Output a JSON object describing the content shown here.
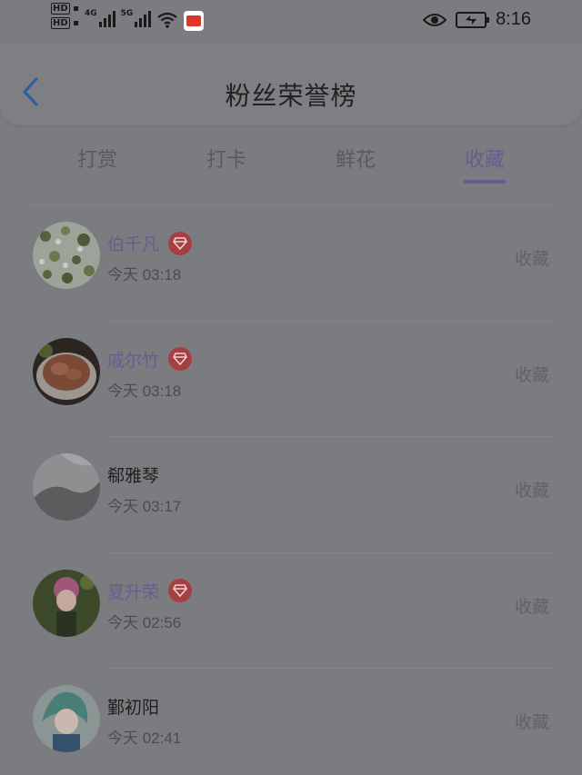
{
  "status_bar": {
    "hd1": "HD",
    "hd2": "HD",
    "net1": "4G",
    "net2": "5G",
    "time": "8:16"
  },
  "header": {
    "title": "粉丝荣誉榜"
  },
  "tabs": [
    {
      "label": "打赏"
    },
    {
      "label": "打卡"
    },
    {
      "label": "鲜花"
    },
    {
      "label": "收藏"
    }
  ],
  "active_tab": "收藏",
  "fans": [
    {
      "name": "伯千凡",
      "time": "今天 03:18",
      "action": "收藏",
      "vip": true,
      "avatar": "flowers"
    },
    {
      "name": "戚尔竹",
      "time": "今天 03:18",
      "action": "收藏",
      "vip": true,
      "avatar": "food"
    },
    {
      "name": "郗雅琴",
      "time": "今天 03:17",
      "action": "收藏",
      "vip": false,
      "avatar": "gray"
    },
    {
      "name": "夏升荣",
      "time": "今天 02:56",
      "action": "收藏",
      "vip": true,
      "avatar": "doll"
    },
    {
      "name": "鄞初阳",
      "time": "今天 02:41",
      "action": "收藏",
      "vip": false,
      "avatar": "anime"
    }
  ],
  "colors": {
    "accent": "#6b5a92",
    "vip_badge": "#a63f3f",
    "back_arrow": "#2f5f9e"
  }
}
